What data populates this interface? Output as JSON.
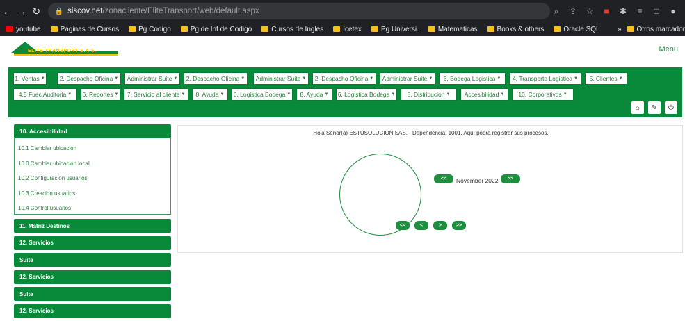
{
  "browser": {
    "url_host": "siscov.net",
    "url_path": "/zonacliente/EliteTransport/web/default.aspx",
    "bookmarks": [
      "youtube",
      "Paginas de Cursos",
      "Pg Codigo",
      "Pg de Inf de Codigo",
      "Cursos de Ingles",
      "Icetex",
      "Pg Universi.",
      "Matematicas",
      "Books & others",
      "Oracle SQL"
    ],
    "bookmarks_more": "»",
    "other_bookmarks": "Otros marcador"
  },
  "header": {
    "logo_text": "ELITE TRANSPORT S.A.S.",
    "menu": "Menu"
  },
  "nav_row1": [
    "1. Ventas",
    "2. Despacho Oficina",
    "Administrar Suite",
    "2. Despacho Oficina",
    "Administrar Suite",
    "2. Despacho Oficina",
    "Administrar Suite",
    "3. Bodega Logistica",
    "4. Transporte Logistica",
    "5. Clientes"
  ],
  "nav_row2": [
    "4.5 Fuec Auditoria",
    "6. Reportes",
    "7. Servicio al cliente",
    "8. Ayuda",
    "6. Logistica Bodega",
    "8. Ayuda",
    "6. Logistica Bodega",
    "8. Distribución",
    "Accesibilidad",
    "10. Corporativos"
  ],
  "sidebar": {
    "open_section": "10. Accesibilidad",
    "items": [
      "10.1 Cambiar ubicacion",
      "10.0 Cambiar ubicacion local",
      "10.2 Configuracion usuarios",
      "10.3 Creacion usuarios",
      "10.4 Control usuarios"
    ],
    "sections": [
      "11. Matriz Destinos",
      "12. Servicios",
      "Suite",
      "12. Servicios",
      "Suite",
      "12. Servicios"
    ]
  },
  "main": {
    "greeting": "Hola Señor(a) ESTUSOLUCION SAS. - Dependencia: 1001. Aquí podrá registrar sus procesos.",
    "prev_month": "<<",
    "month": "November 2022",
    "next_month": ">>",
    "nav_first": "<<",
    "nav_prev": "<",
    "nav_next": ">",
    "nav_last": ">>"
  },
  "colors": {
    "brand_green": "#088a3a",
    "text_green": "#2c7a3c",
    "logo_gold": "#f2c200"
  }
}
